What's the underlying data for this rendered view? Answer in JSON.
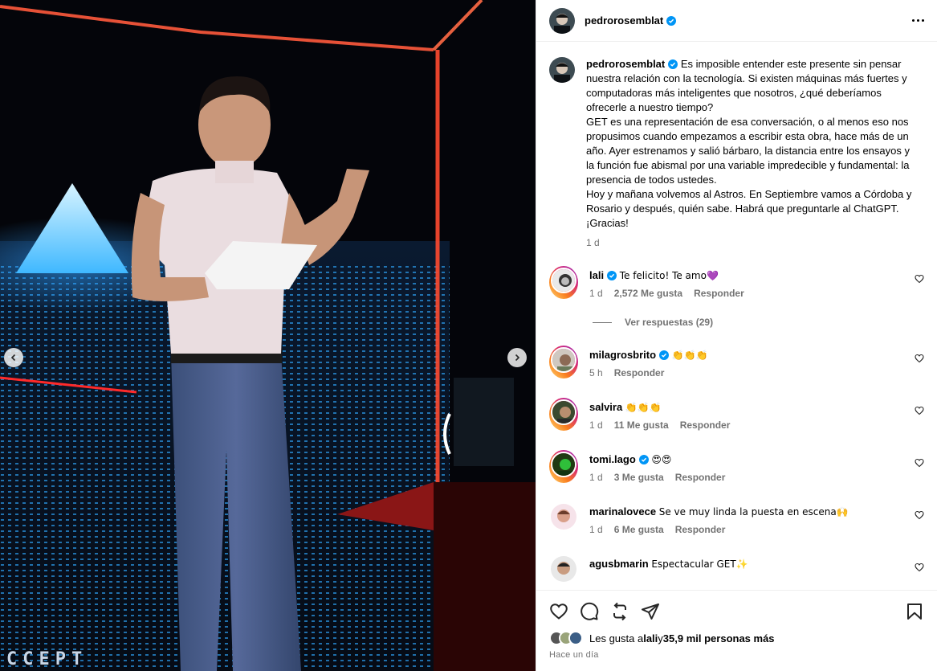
{
  "post": {
    "author": "pedrorosemblat",
    "caption": [
      "Es imposible entender este presente sin pensar nuestra relación con la tecnología. Si existen máquinas más fuertes y computadoras más inteligentes que nosotros, ¿qué deberíamos ofrecerle a nuestro tiempo?",
      "GET es una representación de esa conversación, o al menos eso nos propusimos cuando empezamos a escribir esta obra, hace más de un año. Ayer estrenamos y salió bárbaro, la distancia entre los ensayos y la función fue abismal por una variable impredecible y fundamental: la presencia de todos ustedes.",
      "Hoy y mañana volvemos al Astros. En Septiembre vamos a Córdoba y Rosario y después, quién sabe. Habrá que preguntarle al ChatGPT.",
      "¡Gracias!"
    ],
    "caption_time": "1 d",
    "screen_text": "CCEPT"
  },
  "comments": [
    {
      "user": "lali",
      "verified": true,
      "text": "Te felicito! Te amo💜",
      "time": "1 d",
      "likes": "2,572 Me gusta",
      "reply": "Responder",
      "view_replies": "Ver respuestas (29)"
    },
    {
      "user": "milagrosbrito",
      "verified": true,
      "text": "👏👏👏",
      "time": "5 h",
      "likes": "",
      "reply": "Responder"
    },
    {
      "user": "salvira",
      "verified": false,
      "text": "👏👏👏",
      "time": "1 d",
      "likes": "11 Me gusta",
      "reply": "Responder"
    },
    {
      "user": "tomi.lago",
      "verified": true,
      "text": "😍😍",
      "time": "1 d",
      "likes": "3 Me gusta",
      "reply": "Responder"
    },
    {
      "user": "marinalovece",
      "verified": false,
      "text": "Se ve muy linda la puesta en escena🙌",
      "time": "1 d",
      "likes": "6 Me gusta",
      "reply": "Responder"
    },
    {
      "user": "agusbmarin",
      "verified": false,
      "text": "Espectacular GET✨",
      "time": "",
      "likes": "",
      "reply": ""
    }
  ],
  "likes_summary": {
    "prefix": "Les gusta a ",
    "user": "lali",
    "middle": " y ",
    "count": "35,9 mil personas más"
  },
  "posted_ago": "Hace un día",
  "colors": {
    "verified": "#0095f6",
    "muted": "#737373",
    "border": "#efefef"
  },
  "icons": [
    "more-options-icon",
    "heart-icon",
    "comment-icon",
    "repost-icon",
    "share-icon",
    "bookmark-icon",
    "chevron-left-icon",
    "chevron-right-icon",
    "verified-badge-icon"
  ]
}
